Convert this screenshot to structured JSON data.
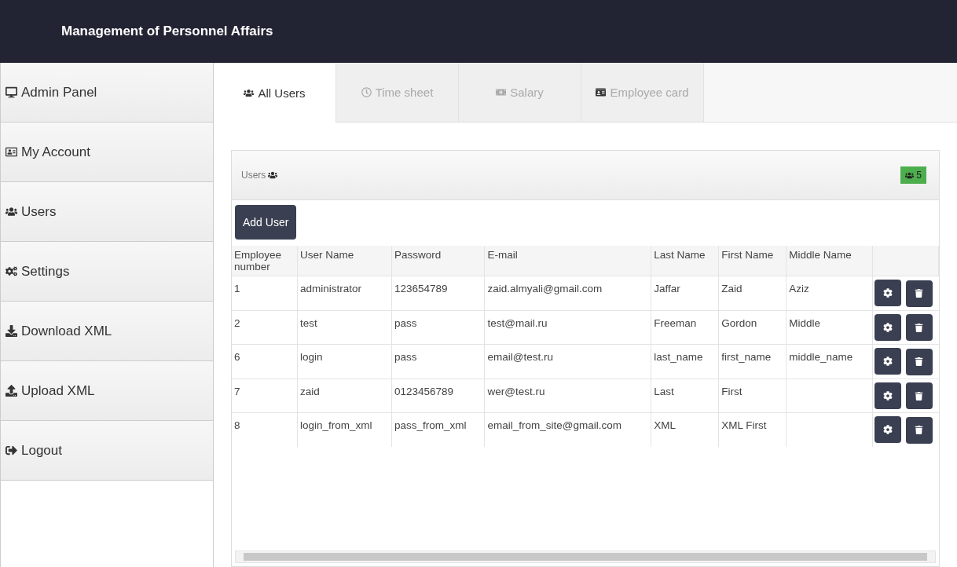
{
  "header": {
    "title": "Management of Personnel Affairs"
  },
  "sidebar": {
    "items": [
      {
        "label": "Admin Panel",
        "selected": false
      },
      {
        "label": "My Account",
        "selected": false
      },
      {
        "label": "Users",
        "selected": false
      },
      {
        "label": "Settings",
        "selected": false
      },
      {
        "label": "Download XML",
        "selected": false
      },
      {
        "label": "Upload XML",
        "selected": false
      },
      {
        "label": "Logout",
        "selected": false
      }
    ]
  },
  "tabs": [
    {
      "label": "All Users",
      "selected": true
    },
    {
      "label": "Time sheet",
      "selected": false
    },
    {
      "label": "Salary",
      "selected": false
    },
    {
      "label": "Employee card",
      "selected": false
    }
  ],
  "panel": {
    "title": "Users",
    "count": "5",
    "add_button": "Add User"
  },
  "table": {
    "columns": [
      "Employee number",
      "User Name",
      "Password",
      "E-mail",
      "Last Name",
      "First Name",
      "Middle Name"
    ],
    "rows": [
      [
        "1",
        "administrator",
        "123654789",
        "zaid.almyali@gmail.com",
        "Jaffar",
        "Zaid",
        "Aziz"
      ],
      [
        "2",
        "test",
        "pass",
        "test@mail.ru",
        "Freeman",
        "Gordon",
        "Middle"
      ],
      [
        "6",
        "login",
        "pass",
        "email@test.ru",
        "last_name",
        "first_name",
        "middle_name"
      ],
      [
        "7",
        "zaid",
        "0123456789",
        "wer@test.ru",
        "Last",
        "First",
        ""
      ],
      [
        "8",
        "login_from_xml",
        "pass_from_xml",
        "email_from_site@gmail.com",
        "XML",
        "XML First",
        ""
      ]
    ]
  }
}
